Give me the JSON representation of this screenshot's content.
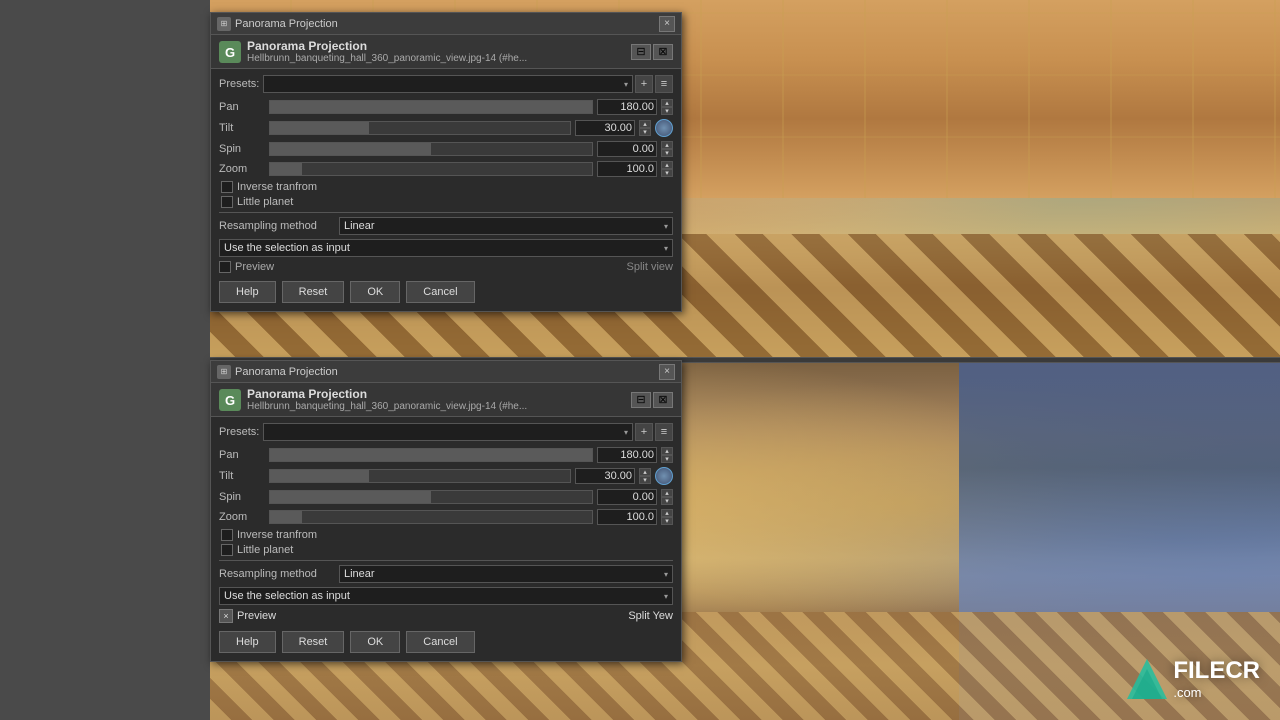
{
  "app": {
    "title": "Panorama Projection"
  },
  "dialog1": {
    "titlebar": {
      "title": "Panorama Projection",
      "close_label": "×"
    },
    "header": {
      "g_logo": "G",
      "title": "Panorama Projection",
      "subtitle": "Hellbrunn_banqueting_hall_360_panoramic_view.jpg-14 (#he..."
    },
    "presets": {
      "label": "Presets:",
      "value": "",
      "add_btn": "+",
      "manage_btn": "≡"
    },
    "fields": {
      "pan_label": "Pan",
      "pan_value": "180.00",
      "tilt_label": "Tilt",
      "tilt_value": "30.00",
      "spin_label": "Spin",
      "spin_value": "0.00",
      "zoom_label": "Zoom",
      "zoom_value": "100.0"
    },
    "checkboxes": {
      "inverse_transform": "Inverse tranfrom",
      "little_planet": "Little planet"
    },
    "resampling": {
      "label": "Resampling method",
      "value": "Linear"
    },
    "selection": {
      "value": "Use the selection as input"
    },
    "preview": {
      "label": "Preview",
      "split_view": "Split view"
    },
    "buttons": {
      "help": "Help",
      "reset": "Reset",
      "ok": "OK",
      "cancel": "Cancel"
    }
  },
  "dialog2": {
    "titlebar": {
      "title": "Panorama Projection",
      "close_label": "×"
    },
    "header": {
      "g_logo": "G",
      "title": "Panorama Projection",
      "subtitle": "Hellbrunn_banqueting_hall_360_panoramic_view.jpg-14 (#he..."
    },
    "presets": {
      "label": "Presets:",
      "value": "",
      "add_btn": "+",
      "manage_btn": "≡"
    },
    "fields": {
      "pan_label": "Pan",
      "pan_value": "180.00",
      "tilt_label": "Tilt",
      "tilt_value": "30.00",
      "spin_label": "Spin",
      "spin_value": "0.00",
      "zoom_label": "Zoom",
      "zoom_value": "100.0"
    },
    "checkboxes": {
      "inverse_transform": "Inverse tranfrom",
      "little_planet": "Little planet"
    },
    "resampling": {
      "label": "Resampling method",
      "value": "Linear"
    },
    "selection": {
      "value": "Use the selection as input"
    },
    "preview": {
      "label": "Preview",
      "split_view": "Split Yew",
      "x_close": "×"
    },
    "buttons": {
      "help": "Help",
      "reset": "Reset",
      "ok": "OK",
      "cancel": "Cancel"
    }
  },
  "filecr": {
    "text": "FILECR",
    "domain": ".com"
  },
  "icons": {
    "chevron_down": "▾",
    "chevron_up": "▴",
    "plus": "+",
    "manage": "≡",
    "close": "×"
  }
}
